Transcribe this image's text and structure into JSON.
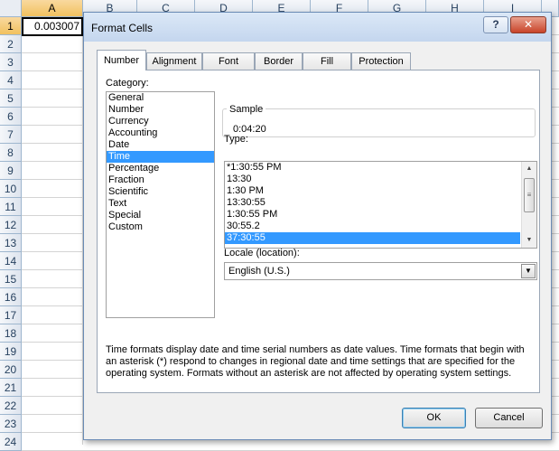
{
  "sheet": {
    "columns": [
      "A",
      "B",
      "C",
      "D",
      "E",
      "F",
      "G",
      "H",
      "I"
    ],
    "rows": [
      "1",
      "2",
      "3",
      "4",
      "5",
      "6",
      "7",
      "8",
      "9",
      "10",
      "11",
      "12",
      "13",
      "14",
      "15",
      "16",
      "17",
      "18",
      "19",
      "20",
      "21",
      "22",
      "23",
      "24"
    ],
    "active_cell_value": "0.003007"
  },
  "dialog": {
    "title": "Format Cells",
    "help_label": "?",
    "close_label": "✕",
    "tabs": [
      "Number",
      "Alignment",
      "Font",
      "Border",
      "Fill",
      "Protection"
    ],
    "category_label": "Category:",
    "categories": [
      "General",
      "Number",
      "Currency",
      "Accounting",
      "Date",
      "Time",
      "Percentage",
      "Fraction",
      "Scientific",
      "Text",
      "Special",
      "Custom"
    ],
    "selected_category": "Time",
    "sample_label": "Sample",
    "sample_value": "0:04:20",
    "type_label": "Type:",
    "type_input_value": "37:30:55",
    "types": [
      "*1:30:55 PM",
      "13:30",
      "1:30 PM",
      "13:30:55",
      "1:30:55 PM",
      "30:55.2",
      "37:30:55"
    ],
    "selected_type": "37:30:55",
    "locale_label": "Locale (location):",
    "locale_value": "English (U.S.)",
    "description": "Time formats display date and time serial numbers as date values.  Time formats that begin with an asterisk (*) respond to changes in regional date and time settings that are specified for the operating system. Formats without an asterisk are not affected by operating system settings.",
    "ok_label": "OK",
    "cancel_label": "Cancel"
  }
}
